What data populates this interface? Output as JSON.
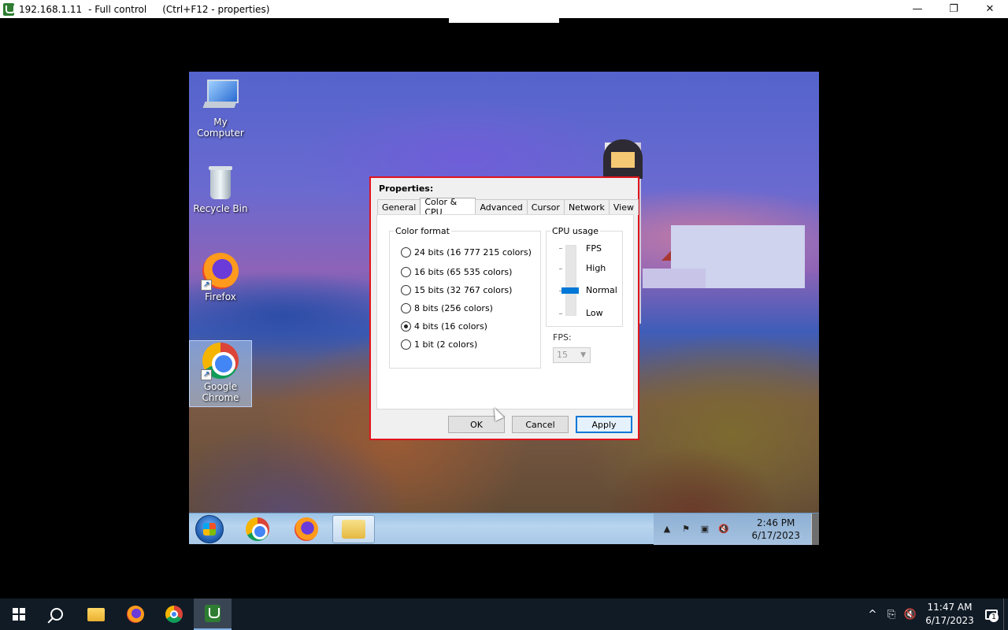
{
  "window": {
    "host": "192.168.1.11",
    "mode": "-  Full control",
    "hint": "(Ctrl+F12 - properties)",
    "minimize": "—",
    "restore": "❐",
    "close": "✕",
    "icon": "remote-control-app-icon"
  },
  "desktop": {
    "icons": [
      {
        "label": "My Computer",
        "icon": "computer-icon"
      },
      {
        "label": "Recycle Bin",
        "icon": "recycle-bin-icon"
      },
      {
        "label": "Firefox",
        "icon": "firefox-icon"
      },
      {
        "label": "Google Chrome",
        "icon": "chrome-icon"
      }
    ]
  },
  "dialog": {
    "title": "Properties:",
    "tabs": [
      "General",
      "Color & CPU",
      "Advanced",
      "Cursor",
      "Network",
      "View"
    ],
    "active_tab": "Color & CPU",
    "color_format": {
      "label": "Color format",
      "options": [
        "24 bits (16 777 215 colors)",
        "16 bits (65 535 colors)",
        "15 bits (32 767 colors)",
        "8 bits (256 colors)",
        "4 bits (16 colors)",
        "1 bit (2 colors)"
      ],
      "selected": "4 bits (16 colors)"
    },
    "cpu_usage": {
      "label": "CPU usage",
      "levels": [
        "FPS",
        "High",
        "Normal",
        "Low"
      ],
      "selected": "Normal"
    },
    "fps": {
      "label": "FPS:",
      "value": "15"
    },
    "buttons": {
      "ok": "OK",
      "cancel": "Cancel",
      "apply": "Apply"
    },
    "accent": "#e0141c"
  },
  "remote_taskbar": {
    "time": "2:46 PM",
    "date": "6/17/2023",
    "apps": [
      "start-orb",
      "chrome-icon",
      "firefox-icon",
      "explorer-icon"
    ]
  },
  "taskbar": {
    "time": "11:47 AM",
    "date": "6/17/2023",
    "notification_count": "1",
    "apps": [
      "start-icon",
      "search-icon",
      "file-explorer-icon",
      "firefox-icon",
      "chrome-icon",
      "remote-control-icon"
    ]
  }
}
